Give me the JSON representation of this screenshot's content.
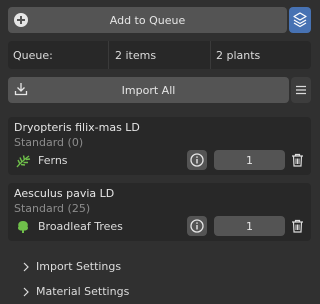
{
  "toolbar": {
    "add_label": "Add to Queue",
    "add_icon": "plus-circle-icon",
    "layers_icon": "layers-icon",
    "accent": "#4772b3"
  },
  "queue": {
    "label": "Queue:",
    "items": "2 items",
    "plants": "2 plants"
  },
  "import": {
    "label": "Import All",
    "icon": "download-icon",
    "menu_icon": "hamburger-icon"
  },
  "plants": [
    {
      "name": "Dryopteris filix-mas LD",
      "subtitle": "Standard (0)",
      "category": "Ferns",
      "category_icon": "fern-icon",
      "quantity": "1"
    },
    {
      "name": "Aesculus pavia LD",
      "subtitle": "Standard (25)",
      "category": "Broadleaf Trees",
      "category_icon": "tree-icon",
      "quantity": "1"
    }
  ],
  "sections": {
    "import_settings": "Import Settings",
    "material_settings": "Material Settings"
  }
}
